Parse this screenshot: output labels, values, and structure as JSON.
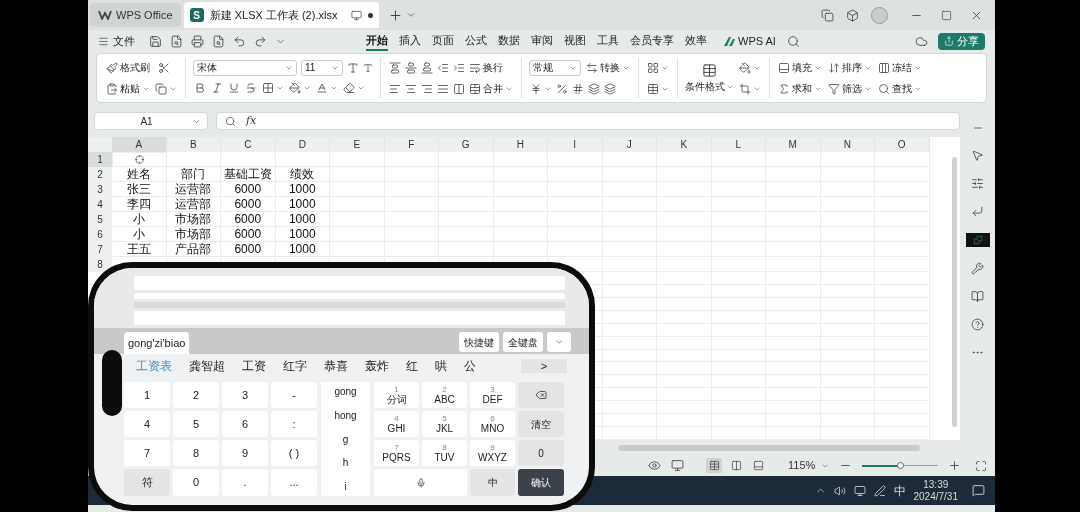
{
  "title_bar": {
    "home_tab": "WPS Office",
    "document_tab": "新建 XLSX 工作表 (2).xlsx",
    "logo_letter": "S"
  },
  "menu_bar": {
    "file": "文件",
    "tabs": [
      {
        "label": "开始",
        "selected": true
      },
      {
        "label": "插入",
        "selected": false
      },
      {
        "label": "页面",
        "selected": false
      },
      {
        "label": "公式",
        "selected": false
      },
      {
        "label": "数据",
        "selected": false
      },
      {
        "label": "审阅",
        "selected": false
      },
      {
        "label": "视图",
        "selected": false
      },
      {
        "label": "工具",
        "selected": false
      },
      {
        "label": "会员专享",
        "selected": false
      },
      {
        "label": "效率",
        "selected": false
      }
    ],
    "ai": "WPS AI",
    "share": "分享"
  },
  "ribbon": {
    "format_painter": "格式刷",
    "paste": "粘贴",
    "font": "宋体",
    "font_size": "11",
    "wrap": "换行",
    "merge": "合并",
    "number_format": "常规",
    "convert": "转换",
    "conditional_format": "条件格式",
    "fill": "填充",
    "sum": "求和",
    "sort": "排序",
    "filter": "筛选",
    "freeze": "冻结",
    "find": "查找"
  },
  "formula_bar": {
    "name_box": "A1",
    "fx": "fx"
  },
  "sheet": {
    "columns": [
      "A",
      "B",
      "C",
      "D",
      "E",
      "F",
      "G",
      "H",
      "I",
      "J",
      "K",
      "L",
      "M",
      "N",
      "O"
    ],
    "rows": [
      {
        "number": "1",
        "cells": [
          "",
          "",
          "",
          ""
        ]
      },
      {
        "number": "2",
        "cells": [
          "姓名",
          "部门",
          "基础工资",
          "绩效"
        ]
      },
      {
        "number": "3",
        "cells": [
          "张三",
          "运营部",
          "6000",
          "1000"
        ]
      },
      {
        "number": "4",
        "cells": [
          "李四",
          "运营部",
          "6000",
          "1000"
        ]
      },
      {
        "number": "5",
        "cells": [
          "小",
          "市场部",
          "6000",
          "1000"
        ]
      },
      {
        "number": "6",
        "cells": [
          "小",
          "市场部",
          "6000",
          "1000"
        ]
      },
      {
        "number": "7",
        "cells": [
          "王五",
          "产品部",
          "6000",
          "1000"
        ]
      },
      {
        "number": "8",
        "cells": [
          "",
          "",
          "",
          ""
        ]
      }
    ]
  },
  "keyboard": {
    "input": "gong'zi'biao",
    "buttons": [
      "快捷键",
      "全键盘"
    ],
    "candidates": [
      {
        "text": "工资表",
        "selected": true
      },
      {
        "text": "龚智超",
        "selected": false
      },
      {
        "text": "工资",
        "selected": false
      },
      {
        "text": "红字",
        "selected": false
      },
      {
        "text": "恭喜",
        "selected": false
      },
      {
        "text": "轰炸",
        "selected": false
      },
      {
        "text": "红",
        "selected": false
      },
      {
        "text": "哄",
        "selected": false
      },
      {
        "text": "公",
        "selected": false
      }
    ],
    "more": ">",
    "left_keys": [
      {
        "label": "1",
        "kind": "plain"
      },
      {
        "label": "2",
        "kind": "plain"
      },
      {
        "label": "3",
        "kind": "plain"
      },
      {
        "label": "-",
        "kind": "plain"
      },
      {
        "label": "4",
        "kind": "plain"
      },
      {
        "label": "5",
        "kind": "plain"
      },
      {
        "label": "6",
        "kind": "plain"
      },
      {
        "label": ":",
        "kind": "plain"
      },
      {
        "label": "7",
        "kind": "plain"
      },
      {
        "label": "8",
        "kind": "plain"
      },
      {
        "label": "9",
        "kind": "plain"
      },
      {
        "label": "( )",
        "kind": "plain"
      },
      {
        "label": "符",
        "kind": "function"
      },
      {
        "label": "0",
        "kind": "plain"
      },
      {
        "label": ".",
        "kind": "plain"
      },
      {
        "label": "...",
        "kind": "plain"
      }
    ],
    "pinyin": [
      "gong",
      "hong",
      "g",
      "h",
      "i"
    ],
    "right_keys": [
      {
        "kind": "t9",
        "digit": "1",
        "label": "分词"
      },
      {
        "kind": "t9",
        "digit": "2",
        "label": "ABC"
      },
      {
        "kind": "t9",
        "digit": "3",
        "label": "DEF"
      },
      {
        "kind": "backspace"
      },
      {
        "kind": "t9",
        "digit": "4",
        "label": "GHI"
      },
      {
        "kind": "t9",
        "digit": "5",
        "label": "JKL"
      },
      {
        "kind": "t9",
        "digit": "6",
        "label": "MNO"
      },
      {
        "kind": "function",
        "label": "清空"
      },
      {
        "kind": "t9",
        "digit": "7",
        "label": "PQRS"
      },
      {
        "kind": "t9",
        "digit": "8",
        "label": "TUV"
      },
      {
        "kind": "t9",
        "digit": "9",
        "label": "WXYZ"
      },
      {
        "kind": "function",
        "label": "0"
      },
      {
        "kind": "space"
      },
      {
        "kind": "function",
        "label": "中"
      },
      {
        "kind": "enter",
        "label": "确认"
      }
    ]
  },
  "status_bar": {
    "views": [
      {
        "selected": true
      },
      {
        "selected": false
      },
      {
        "selected": false
      }
    ],
    "zoom": "115%",
    "zoom_slider": {
      "level": 0.5
    }
  },
  "taskbar": {
    "ime": "中",
    "time": "13:39",
    "date": "2024/7/31"
  }
}
